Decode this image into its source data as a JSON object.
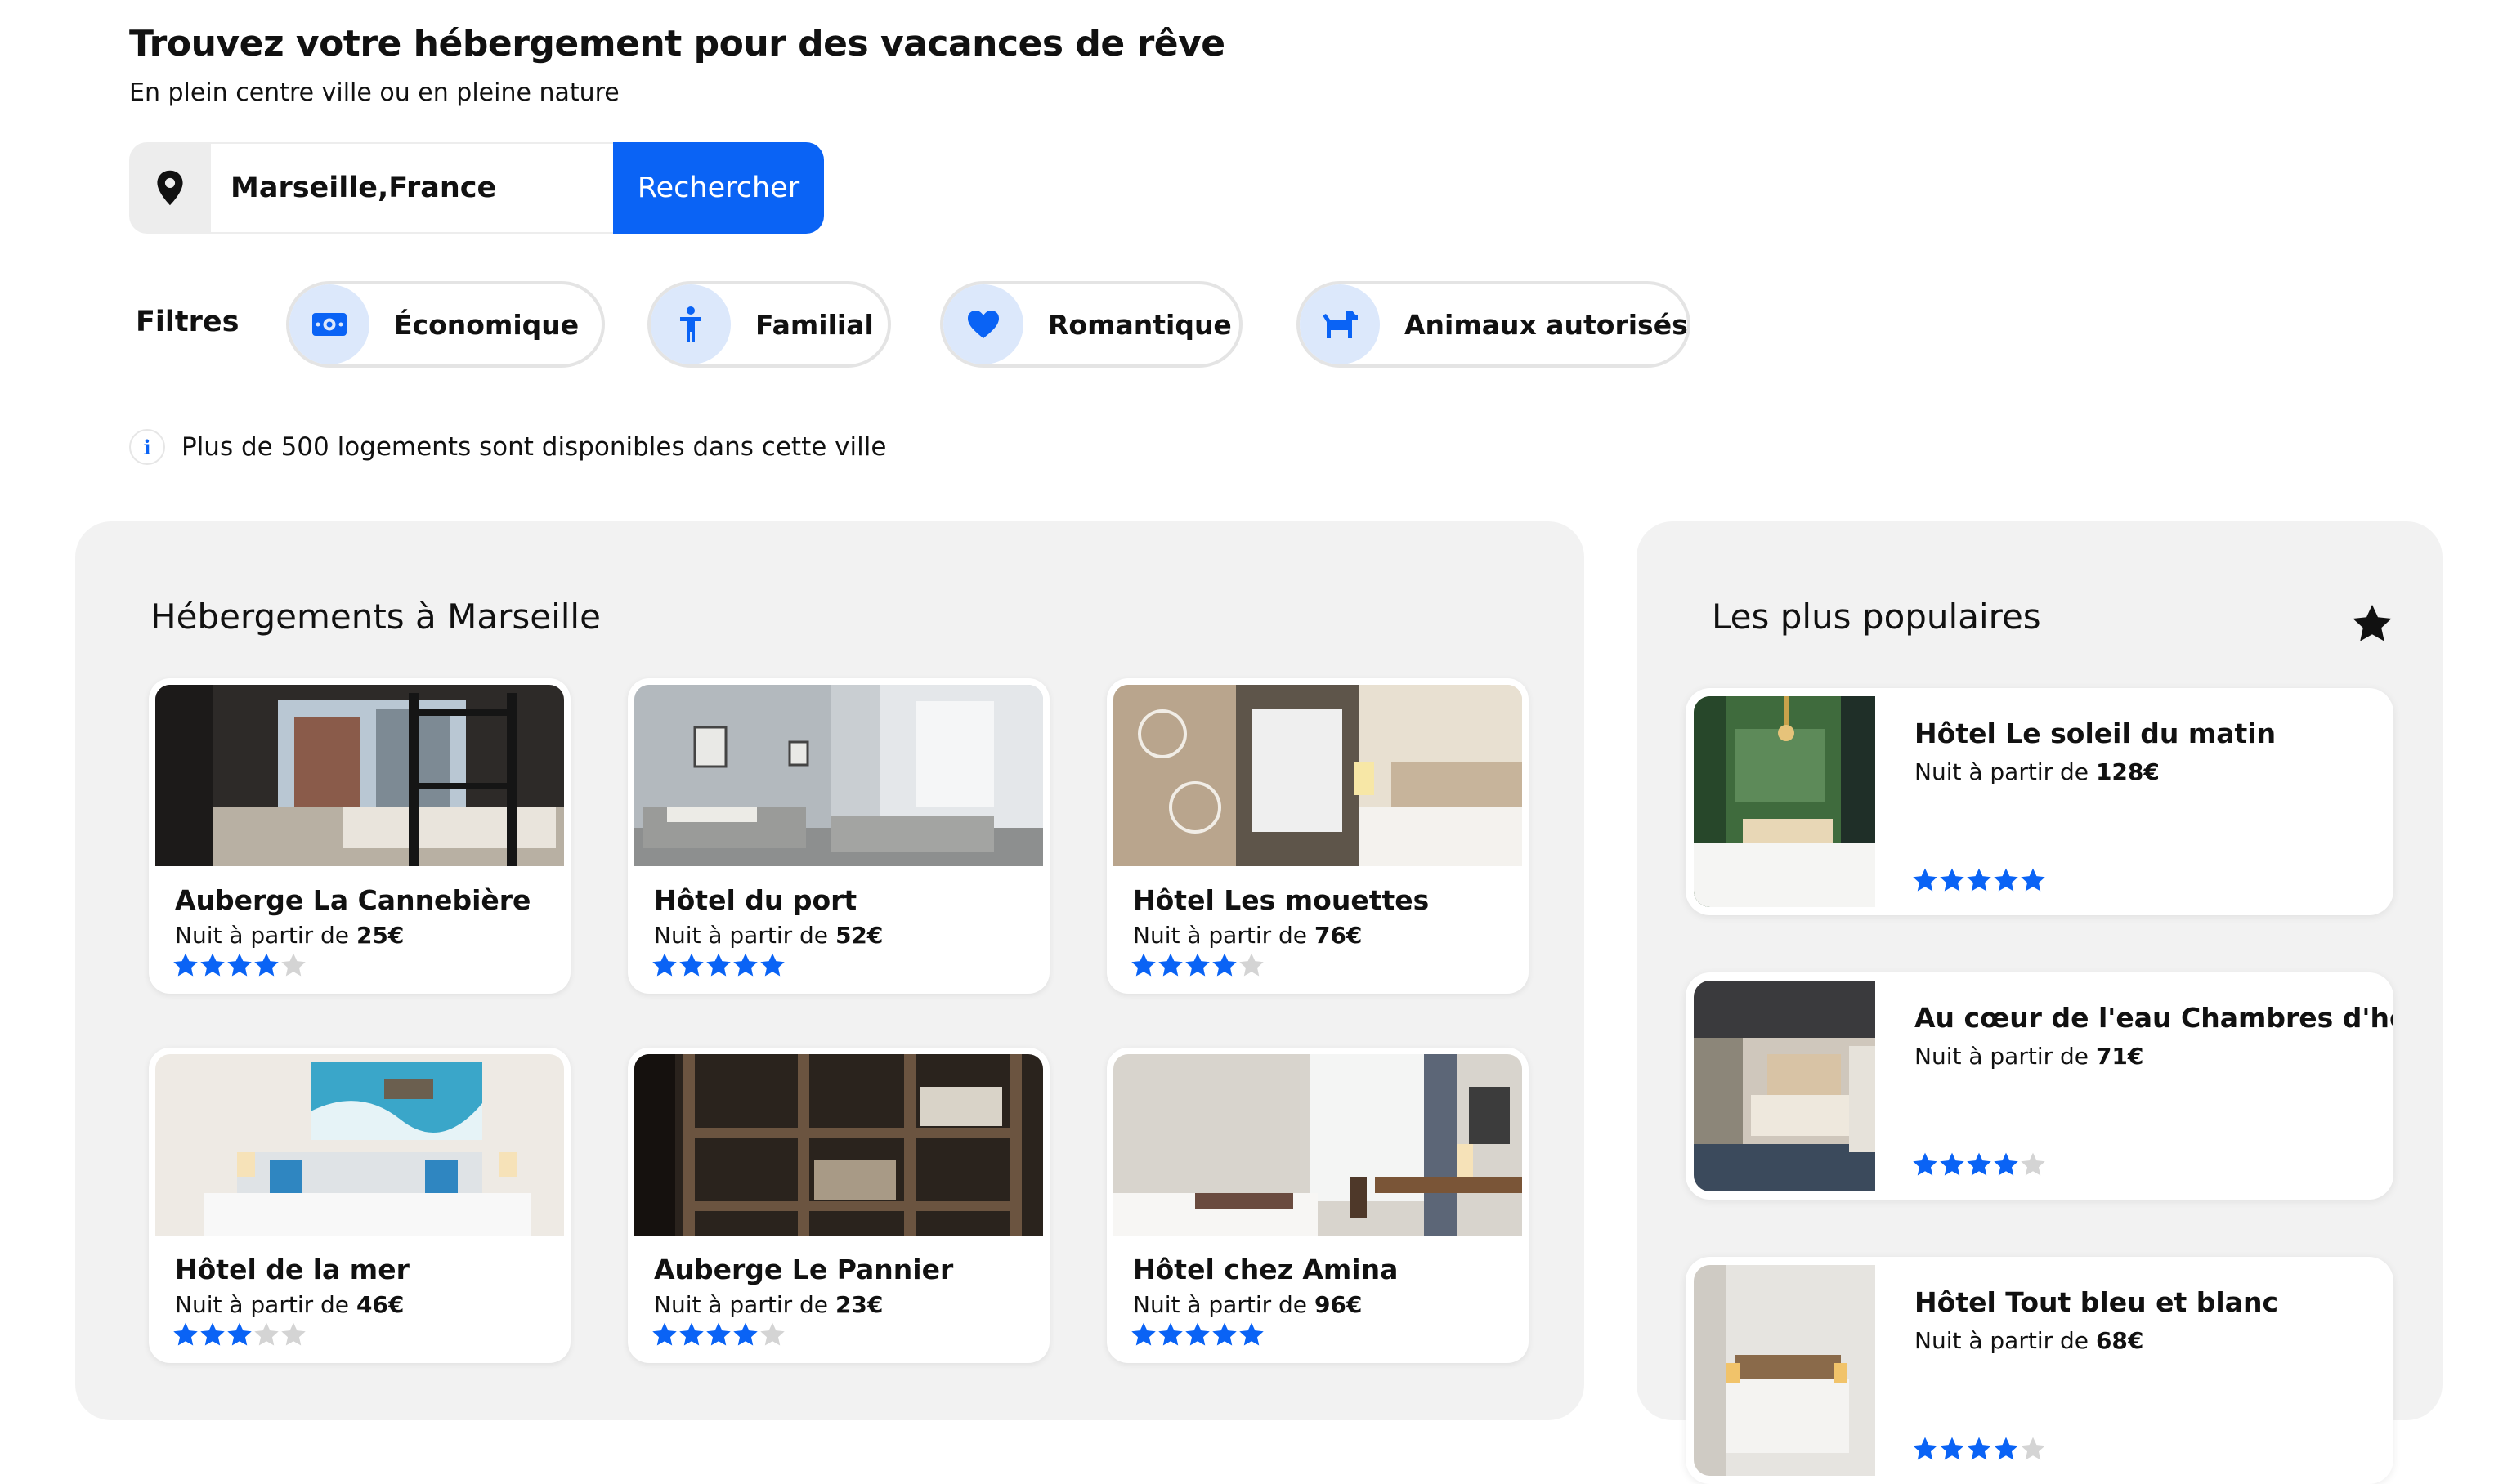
{
  "header": {
    "title": "Trouvez votre hébergement pour des vacances de rêve",
    "subtitle": "En plein centre ville ou en pleine nature"
  },
  "search": {
    "value": "Marseille,France",
    "button_label": "Rechercher",
    "icon": "map-pin-icon"
  },
  "filters": {
    "label": "Filtres",
    "items": [
      {
        "label": "Économique",
        "icon": "money-icon"
      },
      {
        "label": "Familial",
        "icon": "child-icon"
      },
      {
        "label": "Romantique",
        "icon": "heart-icon"
      },
      {
        "label": "Animaux autorisés",
        "icon": "dog-icon"
      }
    ]
  },
  "info": {
    "icon": "info-icon",
    "text": "Plus de 500 logements sont disponibles dans cette ville"
  },
  "listings": {
    "title": "Hébergements à Marseille",
    "price_prefix": "Nuit à partir de",
    "items": [
      {
        "name": "Auberge La Cannebière",
        "price": "25€",
        "rating": 4
      },
      {
        "name": "Hôtel du port",
        "price": "52€",
        "rating": 5
      },
      {
        "name": "Hôtel Les mouettes",
        "price": "76€",
        "rating": 4
      },
      {
        "name": "Hôtel de la mer",
        "price": "46€",
        "rating": 3
      },
      {
        "name": "Auberge Le Pannier",
        "price": "23€",
        "rating": 4
      },
      {
        "name": "Hôtel chez Amina",
        "price": "96€",
        "rating": 5
      }
    ]
  },
  "popular": {
    "title": "Les plus populaires",
    "icon": "star-icon",
    "price_prefix": "Nuit à partir de",
    "items": [
      {
        "name": "Hôtel Le soleil du matin",
        "price": "128€",
        "rating": 5
      },
      {
        "name": "Au cœur de l'eau Chambres d'hôtes",
        "price": "71€",
        "rating": 4
      },
      {
        "name": "Hôtel Tout bleu et blanc",
        "price": "68€",
        "rating": 4
      }
    ]
  },
  "colors": {
    "accent": "#0a63f5",
    "chip_icon_bg": "#dce8fb",
    "panel_bg": "#f2f2f2",
    "star_filled": "#0a63f5",
    "star_empty": "#d4d4d4"
  }
}
